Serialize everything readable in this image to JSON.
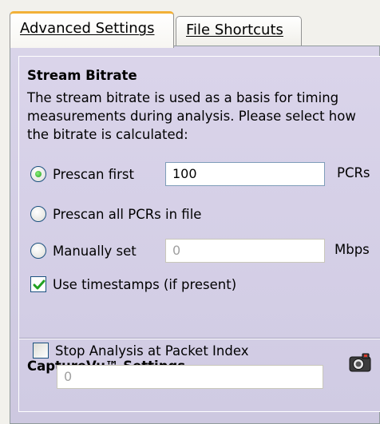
{
  "tabs": [
    {
      "label": "Advanced Settings",
      "active": true
    },
    {
      "label": "File Shortcuts",
      "active": false
    }
  ],
  "stream_bitrate": {
    "title": "Stream Bitrate",
    "description": "The stream bitrate is used as a basis for timing measurements during analysis. Please select how the bitrate is calculated:",
    "options": {
      "prescan_first": {
        "label": "Prescan first",
        "value": "100",
        "unit": "PCRs",
        "selected": true
      },
      "prescan_all": {
        "label": "Prescan all PCRs in file",
        "selected": false
      },
      "manual": {
        "label": "Manually set",
        "value": "0",
        "unit": "Mbps",
        "selected": false
      }
    },
    "use_timestamps": {
      "label": "Use timestamps (if present)",
      "checked": true
    }
  },
  "capturevu": {
    "title": "CaptureVu™ Settings",
    "icon": "camera-icon",
    "stop_analysis": {
      "label": "Stop Analysis at Packet Index",
      "checked": false,
      "value": "0"
    }
  },
  "colors": {
    "tab_accent": "#f2b138",
    "panel_bg": "#d6d0e8",
    "radio_selected": "#21a121",
    "check_mark": "#21a121"
  }
}
